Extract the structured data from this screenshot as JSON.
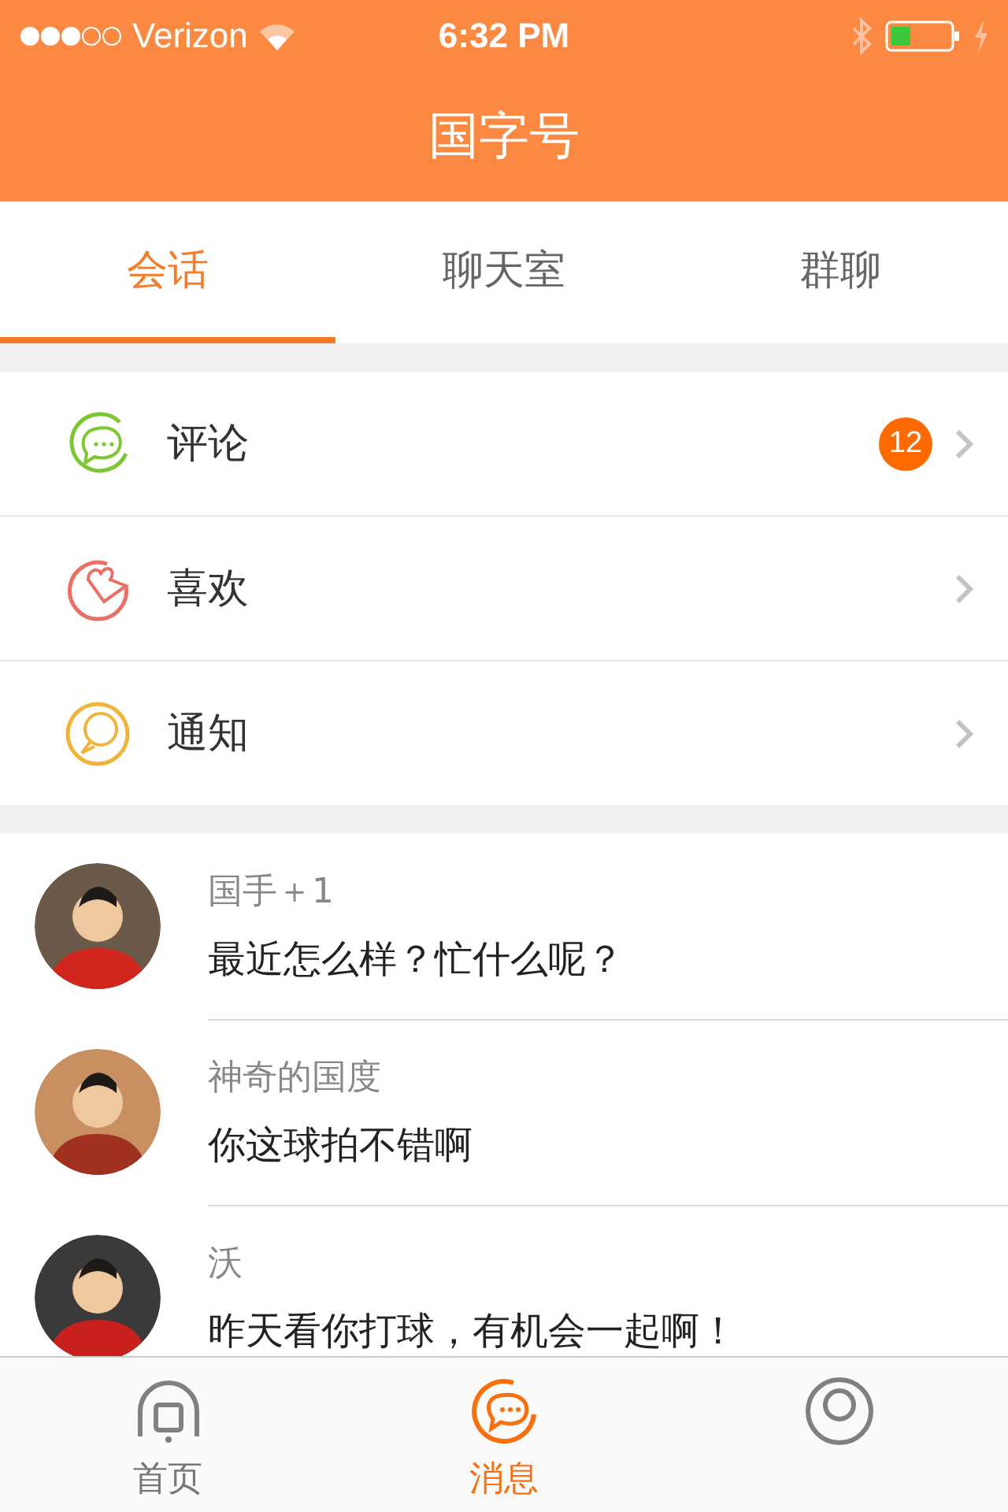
{
  "status_bar": {
    "carrier": "Verizon",
    "time": "6:32 PM"
  },
  "nav_bar": {
    "title": "国字号"
  },
  "tabs": [
    {
      "label": "会话",
      "selected": true
    },
    {
      "label": "聊天室",
      "selected": false
    },
    {
      "label": "群聊",
      "selected": false
    }
  ],
  "categories": [
    {
      "label": "评论",
      "kind": "comment",
      "color": "#7dc832",
      "badge": "12"
    },
    {
      "label": "喜欢",
      "kind": "like",
      "color": "#ea6f64"
    },
    {
      "label": "通知",
      "kind": "notice",
      "color": "#f0b43c"
    }
  ],
  "conversations": [
    {
      "name": "国手＋1",
      "message": "最近怎么样？忙什么呢？"
    },
    {
      "name": "神奇的国度",
      "message": "你这球拍不错啊"
    },
    {
      "name": "沃",
      "message": "昨天看你打球，有机会一起啊！"
    }
  ],
  "tab_bar": [
    {
      "label": "首页",
      "kind": "home",
      "selected": false
    },
    {
      "label": "消息",
      "kind": "messages",
      "selected": true
    },
    {
      "kind": "profile",
      "selected": false
    }
  ]
}
